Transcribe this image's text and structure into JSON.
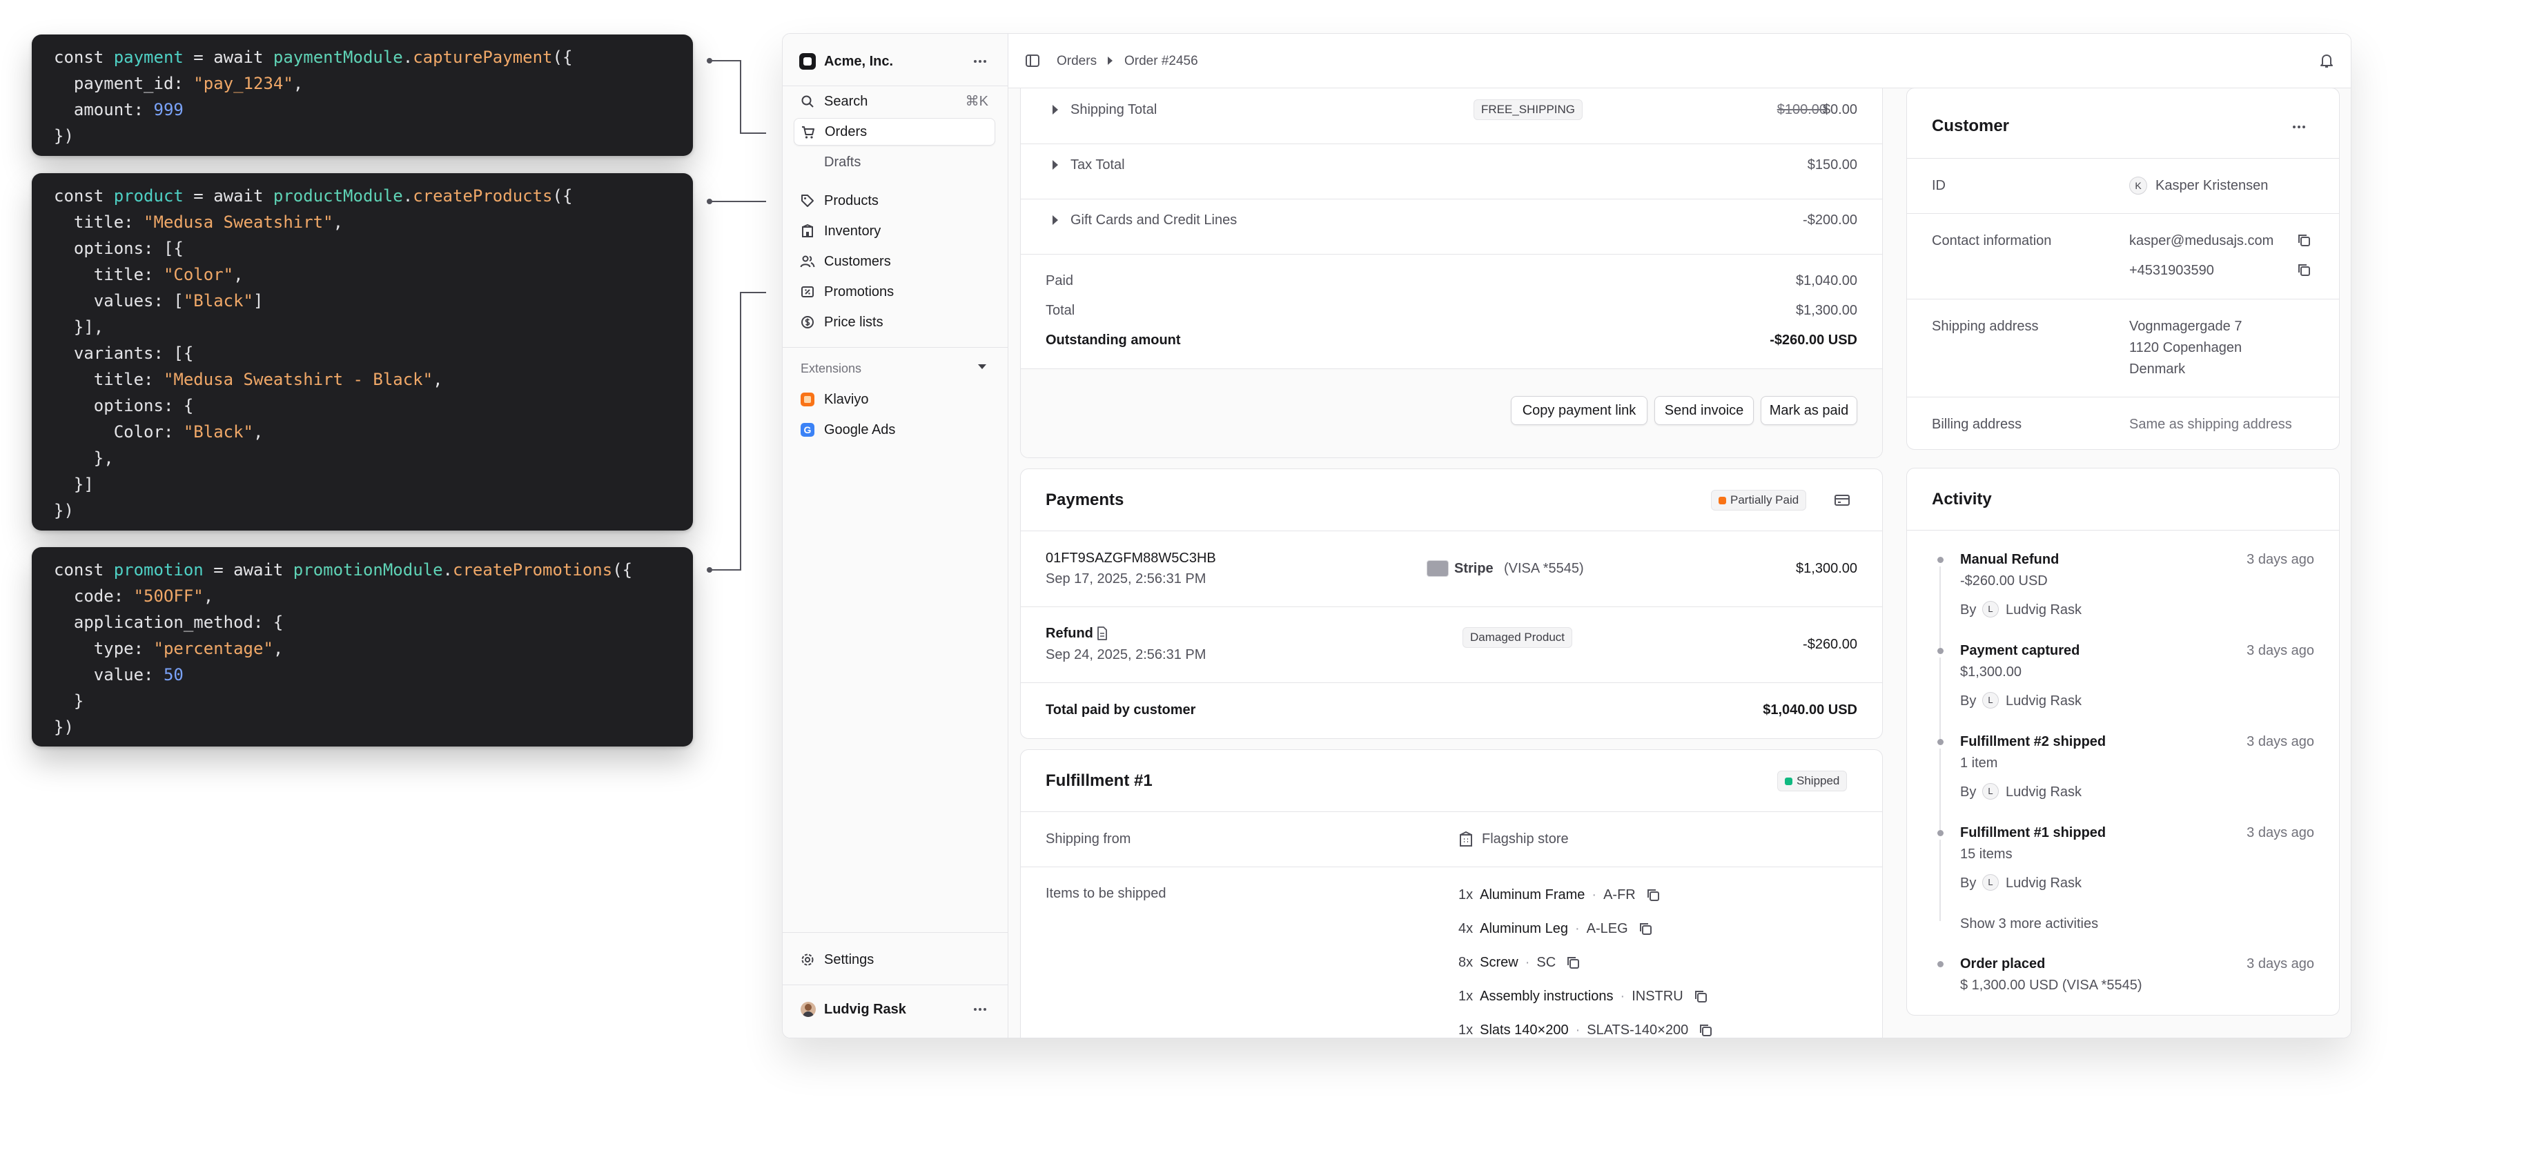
{
  "code_blocks": [
    {
      "lines": [
        [
          [
            "kw",
            "const "
          ],
          [
            "var",
            "payment"
          ],
          [
            "kw",
            " = await "
          ],
          [
            "fn",
            "paymentModule"
          ],
          [
            "kw",
            "."
          ],
          [
            "meth",
            "capturePayment"
          ],
          [
            "kw",
            "({"
          ]
        ],
        [
          [
            "prop",
            "  payment_id: "
          ],
          [
            "str",
            "\"pay_1234\""
          ],
          [
            "kw",
            ","
          ]
        ],
        [
          [
            "prop",
            "  amount: "
          ],
          [
            "num",
            "999"
          ]
        ],
        [
          [
            "kw",
            "})"
          ]
        ]
      ]
    },
    {
      "lines": [
        [
          [
            "kw",
            "const "
          ],
          [
            "var",
            "product"
          ],
          [
            "kw",
            " = await "
          ],
          [
            "fn",
            "productModule"
          ],
          [
            "kw",
            "."
          ],
          [
            "meth",
            "createProducts"
          ],
          [
            "kw",
            "({"
          ]
        ],
        [
          [
            "prop",
            "  title: "
          ],
          [
            "str",
            "\"Medusa Sweatshirt\""
          ],
          [
            "kw",
            ","
          ]
        ],
        [
          [
            "prop",
            "  options: [{"
          ]
        ],
        [
          [
            "prop",
            "    title: "
          ],
          [
            "str",
            "\"Color\""
          ],
          [
            "kw",
            ","
          ]
        ],
        [
          [
            "prop",
            "    values: ["
          ],
          [
            "str",
            "\"Black\""
          ],
          [
            "kw",
            "]"
          ]
        ],
        [
          [
            "kw",
            "  }],"
          ]
        ],
        [
          [
            "prop",
            "  variants: [{"
          ]
        ],
        [
          [
            "prop",
            "    title: "
          ],
          [
            "str",
            "\"Medusa Sweatshirt - Black\""
          ],
          [
            "kw",
            ","
          ]
        ],
        [
          [
            "prop",
            "    options: {"
          ]
        ],
        [
          [
            "prop",
            "      Color: "
          ],
          [
            "str",
            "\"Black\""
          ],
          [
            "kw",
            ","
          ]
        ],
        [
          [
            "kw",
            "    },"
          ]
        ],
        [
          [
            "kw",
            "  }]"
          ]
        ],
        [
          [
            "kw",
            "})"
          ]
        ]
      ]
    },
    {
      "lines": [
        [
          [
            "kw",
            "const "
          ],
          [
            "var",
            "promotion"
          ],
          [
            "kw",
            " = await "
          ],
          [
            "fn",
            "promotionModule"
          ],
          [
            "kw",
            "."
          ],
          [
            "meth",
            "createPromotions"
          ],
          [
            "kw",
            "({"
          ]
        ],
        [
          [
            "prop",
            "  code: "
          ],
          [
            "str",
            "\"50OFF\""
          ],
          [
            "kw",
            ","
          ]
        ],
        [
          [
            "prop",
            "  application_method: {"
          ]
        ],
        [
          [
            "prop",
            "    type: "
          ],
          [
            "str",
            "\"percentage\""
          ],
          [
            "kw",
            ","
          ]
        ],
        [
          [
            "prop",
            "    value: "
          ],
          [
            "num",
            "50"
          ]
        ],
        [
          [
            "kw",
            "  }"
          ]
        ],
        [
          [
            "kw",
            "})"
          ]
        ]
      ]
    }
  ],
  "sidebar": {
    "store_name": "Acme, Inc.",
    "search_label": "Search",
    "search_shortcut": "⌘K",
    "nav": {
      "orders": "Orders",
      "drafts": "Drafts",
      "products": "Products",
      "inventory": "Inventory",
      "customers": "Customers",
      "promotions": "Promotions",
      "price_lists": "Price lists"
    },
    "extensions_label": "Extensions",
    "extensions": {
      "klaviyo": "Klaviyo",
      "google_ads": "Google Ads",
      "google_ads_letter": "G"
    },
    "settings_label": "Settings",
    "user_name": "Ludvig Rask"
  },
  "breadcrumb": {
    "orders": "Orders",
    "order": "Order #2456"
  },
  "summary": {
    "shipping_label": "Shipping Total",
    "shipping_code": "FREE_SHIPPING",
    "shipping_original": "$100.00",
    "shipping_value": "$0.00",
    "tax_label": "Tax Total",
    "tax_value": "$150.00",
    "gift_label": "Gift Cards and Credit Lines",
    "gift_value": "-$200.00",
    "paid_label": "Paid",
    "paid_value": "$1,040.00",
    "total_label": "Total",
    "total_value": "$1,300.00",
    "outstanding_label": "Outstanding amount",
    "outstanding_value": "-$260.00 USD",
    "btn_copy_link": "Copy payment link",
    "btn_send_invoice": "Send invoice",
    "btn_mark_paid": "Mark as paid"
  },
  "payments": {
    "title": "Payments",
    "status": "Partially Paid",
    "status_color": "#f97316",
    "payment_id": "01FT9SAZGFM88W5C3HB",
    "payment_date": "Sep 17, 2025, 2:56:31 PM",
    "provider": "Stripe",
    "card": "(VISA *5545)",
    "payment_amount": "$1,300.00",
    "refund_label": "Refund",
    "refund_date": "Sep 24, 2025, 2:56:31 PM",
    "refund_reason": "Damaged Product",
    "refund_amount": "-$260.00",
    "total_label": "Total paid by customer",
    "total_value": "$1,040.00 USD"
  },
  "fulfillment": {
    "title": "Fulfillment #1",
    "status": "Shipped",
    "status_color": "#10b981",
    "shipping_from_label": "Shipping from",
    "shipping_from_value": "Flagship store",
    "items_label": "Items to be shipped",
    "items": [
      {
        "qty": "1x",
        "name": "Aluminum Frame",
        "sku": "A-FR"
      },
      {
        "qty": "4x",
        "name": "Aluminum Leg",
        "sku": "A-LEG"
      },
      {
        "qty": "8x",
        "name": "Screw",
        "sku": "SC"
      },
      {
        "qty": "1x",
        "name": "Assembly instructions",
        "sku": "INSTRU"
      },
      {
        "qty": "1x",
        "name": "Slats 140×200",
        "sku": "SLATS-140×200"
      }
    ]
  },
  "customer": {
    "title": "Customer",
    "id_label": "ID",
    "id_initial": "K",
    "id_value": "Kasper Kristensen",
    "contact_label": "Contact information",
    "email": "kasper@medusajs.com",
    "phone": "+4531903590",
    "shipping_label": "Shipping address",
    "address_line1": "Vognmagergade 7",
    "address_line2": "1120 Copenhagen",
    "address_line3": "Denmark",
    "billing_label": "Billing address",
    "billing_value": "Same as shipping address"
  },
  "activity": {
    "title": "Activity",
    "by_label": "By",
    "items": [
      {
        "title": "Manual Refund",
        "detail": "-$260.00 USD",
        "time": "3 days ago",
        "initial": "L",
        "user": "Ludvig Rask"
      },
      {
        "title": "Payment captured",
        "detail": "$1,300.00",
        "time": "3 days ago",
        "initial": "L",
        "user": "Ludvig Rask"
      },
      {
        "title": "Fulfillment #2 shipped",
        "detail": "1 item",
        "time": "3 days ago",
        "initial": "L",
        "user": "Ludvig Rask"
      },
      {
        "title": "Fulfillment #1 shipped",
        "detail": "15 items",
        "time": "3 days ago",
        "initial": "L",
        "user": "Ludvig Rask"
      }
    ],
    "show_more": "Show 3 more activities",
    "last_title": "Order placed",
    "last_detail": "$ 1,300.00 USD (VISA *5545)",
    "last_time": "3 days ago"
  }
}
